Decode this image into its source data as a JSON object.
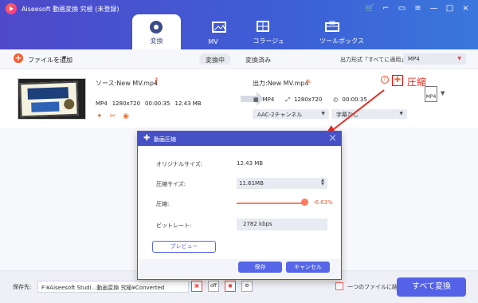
{
  "window": {
    "title": "Aiseesoft 動画変換 究極 (未登録)"
  },
  "tabs": [
    {
      "label": "変換"
    },
    {
      "label": "MV"
    },
    {
      "label": "コラージュ"
    },
    {
      "label": "ツールボックス"
    }
  ],
  "toolbar": {
    "add_file": "ファイルを追加",
    "converting": "変換中",
    "converted": "変換済み",
    "format_label": "出力形式「すべてに適用」:",
    "format_value": "MP4"
  },
  "file": {
    "source": "ソース:New MV.mp4",
    "format": "MP4",
    "resolution": "1280x720",
    "duration": "00:00:35",
    "size": "12.43 MB",
    "output": "出力:New MV.mp4",
    "output_format": "MP4",
    "output_resolution": "1280x720",
    "output_duration": "00:00:35",
    "audio": "AAC-2チャンネル",
    "subtitle": "字幕なし",
    "compress_label": "圧縮"
  },
  "modal": {
    "title": "動画圧縮",
    "original_size_label": "オリジナルサイズ:",
    "original_size": "12.43 MB",
    "compress_size_label": "圧縮サイズ:",
    "compress_size": "11.61MB",
    "compress_label": "圧縮:",
    "percent": "-6.63%",
    "bitrate_label": "ビットレート:",
    "bitrate": "2782 kbps",
    "preview": "プレビュー",
    "save": "保存",
    "cancel": "キャンセル"
  },
  "bottom": {
    "save_to": "保存先:",
    "path": "F:¥Aiseesoft Studi...動画変換 究極¥Converted",
    "combine": "一つのファイルに結合",
    "convert_all": "すべて変換"
  }
}
